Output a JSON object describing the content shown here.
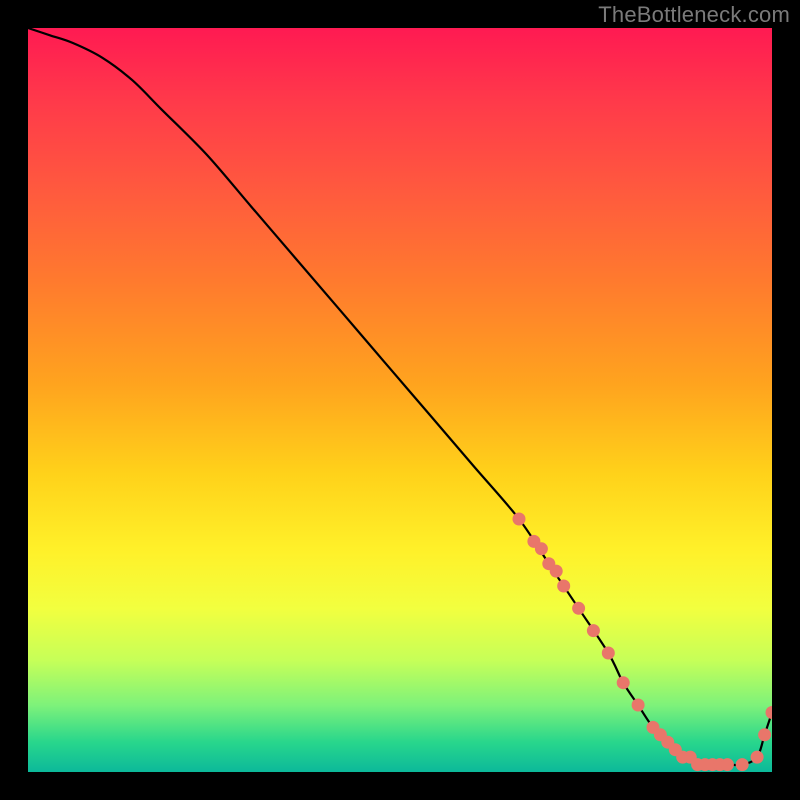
{
  "watermark": "TheBottleneck.com",
  "colors": {
    "dot": "#e9766a",
    "line": "#000000",
    "frame_bg": "#000000"
  },
  "chart_data": {
    "type": "line",
    "title": "",
    "xlabel": "",
    "ylabel": "",
    "xlim": [
      0,
      100
    ],
    "ylim": [
      0,
      100
    ],
    "grid": false,
    "legend": false,
    "x": [
      0,
      3,
      6,
      10,
      14,
      18,
      24,
      30,
      36,
      42,
      48,
      54,
      60,
      66,
      70,
      74,
      78,
      80,
      82,
      84,
      86,
      88,
      90,
      92,
      94,
      96,
      98,
      99,
      100
    ],
    "values": [
      100,
      99,
      98,
      96,
      93,
      89,
      83,
      76,
      69,
      62,
      55,
      48,
      41,
      34,
      28,
      22,
      16,
      12,
      9,
      6,
      4,
      2,
      1,
      1,
      1,
      1,
      2,
      5,
      8
    ],
    "markers_x": [
      66,
      68,
      69,
      70,
      71,
      72,
      74,
      76,
      78,
      80,
      82,
      84,
      85,
      86,
      87,
      88,
      89,
      90,
      91,
      92,
      93,
      94,
      96,
      98,
      99,
      100
    ],
    "markers_values": [
      34,
      31,
      30,
      28,
      27,
      25,
      22,
      19,
      16,
      12,
      9,
      6,
      5,
      4,
      3,
      2,
      2,
      1,
      1,
      1,
      1,
      1,
      1,
      2,
      5,
      8
    ]
  }
}
